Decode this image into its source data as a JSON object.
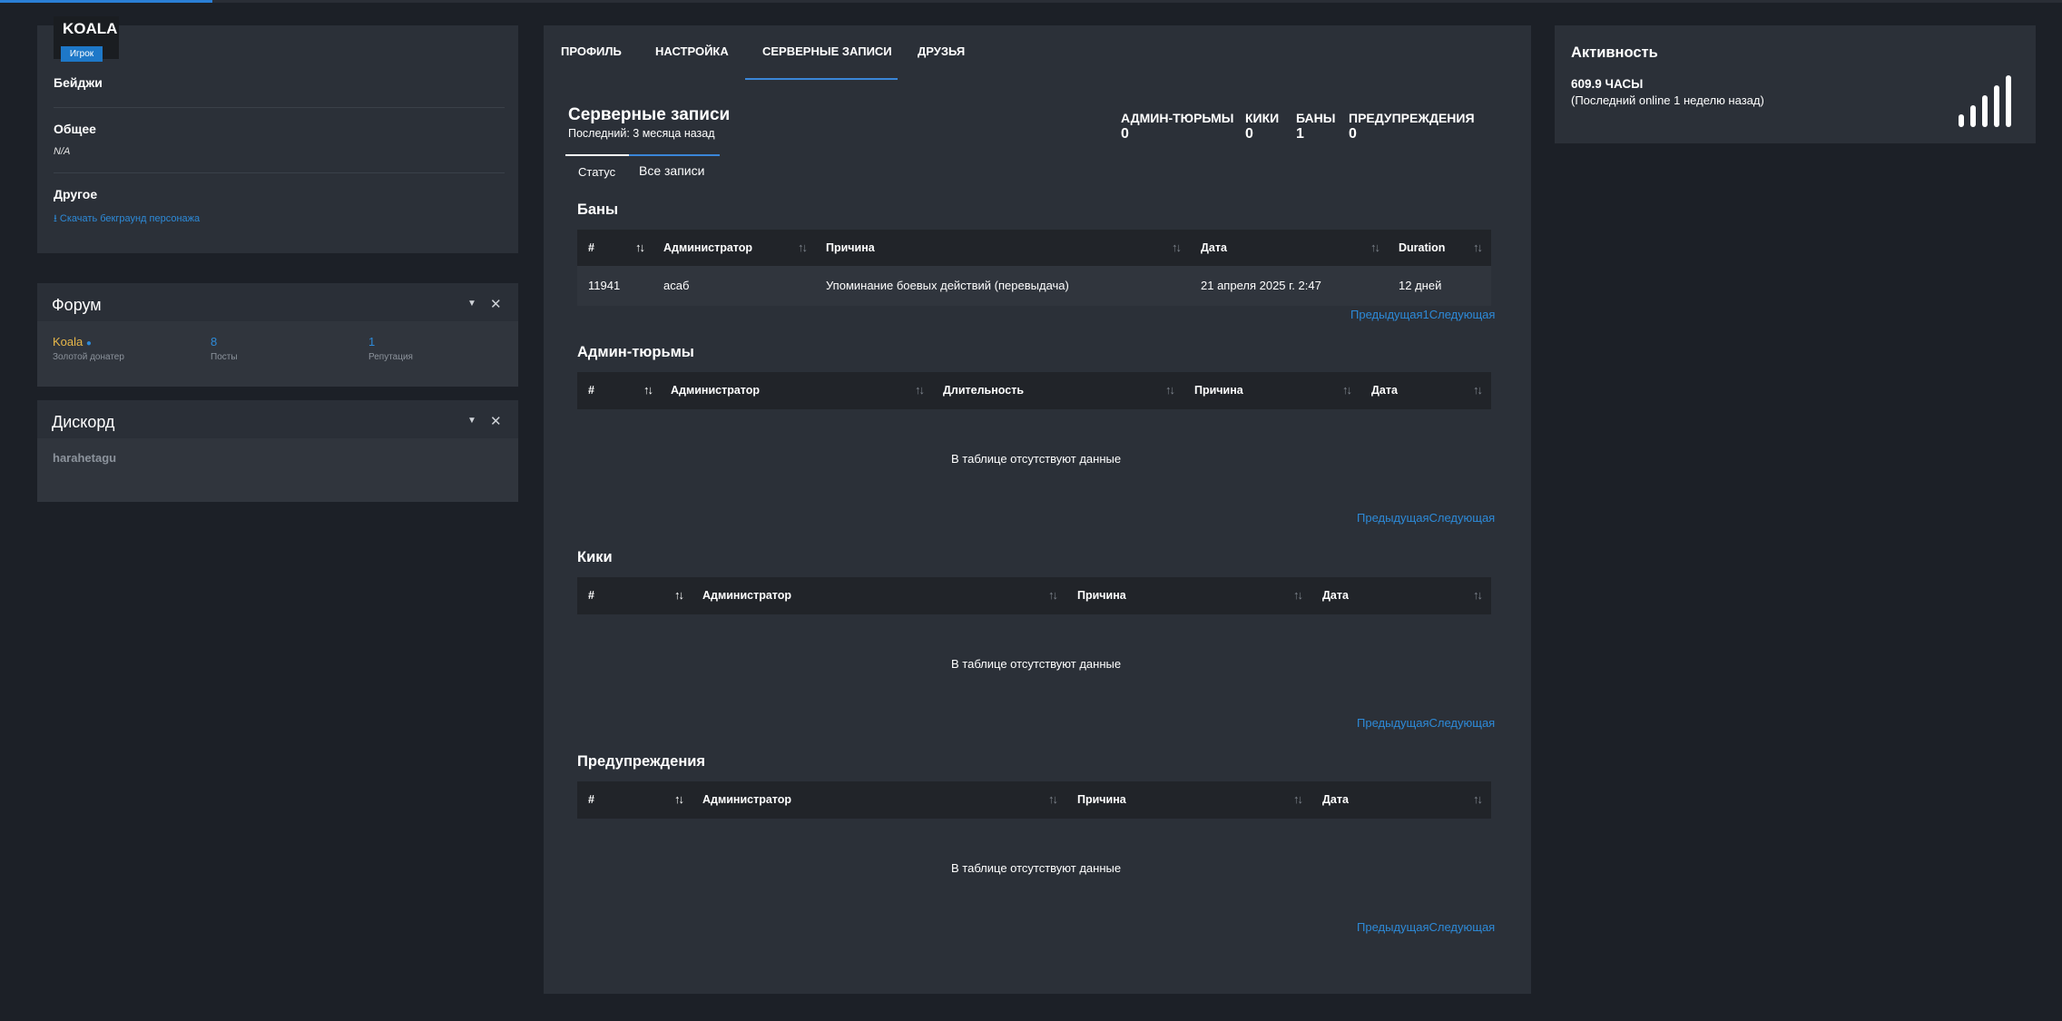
{
  "player": {
    "name": "KOALA",
    "role": "Игрок",
    "badges_label": "Бейджи",
    "general_label": "Общее",
    "general_value": "N/A",
    "other_label": "Другое",
    "download_link": "Скачать бекграунд персонажа"
  },
  "forum": {
    "title": "Форум",
    "username": "Koala",
    "user_rank": "Золотой донатер",
    "posts_value": "8",
    "posts_label": "Посты",
    "rep_value": "1",
    "rep_label": "Репутация"
  },
  "discord": {
    "title": "Дискорд",
    "username": "harahetagu"
  },
  "tabs": [
    "ПРОФИЛЬ",
    "НАСТРОЙКА",
    "СЕРВЕРНЫЕ ЗАПИСИ",
    "ДРУЗЬЯ"
  ],
  "records": {
    "title": "Серверные записи",
    "subtitle": "Последний: 3 месяца назад",
    "subtabs": [
      "Статус",
      "Все записи"
    ],
    "stats": [
      {
        "label": "АДМИН-ТЮРЬМЫ",
        "value": "0"
      },
      {
        "label": "КИКИ",
        "value": "0"
      },
      {
        "label": "БАНЫ",
        "value": "1"
      },
      {
        "label": "ПРЕДУПРЕЖДЕНИЯ",
        "value": "0"
      }
    ]
  },
  "bans": {
    "title": "Баны",
    "headers": [
      "#",
      "Администратор",
      "Причина",
      "Дата",
      "Duration"
    ],
    "rows": [
      [
        "11941",
        "acaб",
        "Упоминание боевых действий (перевыдача)",
        "21 апреля 2025 г. 2:47",
        "12 дней"
      ]
    ],
    "pager_prev": "Предыдущая",
    "pager_page": "1",
    "pager_next": "Следующая"
  },
  "jails": {
    "title": "Админ-тюрьмы",
    "headers": [
      "#",
      "Администратор",
      "Длительность",
      "Причина",
      "Дата"
    ],
    "empty": "В таблице отсутствуют данные",
    "pager_prev": "Предыдущая",
    "pager_next": "Следующая"
  },
  "kicks": {
    "title": "Кики",
    "headers": [
      "#",
      "Администратор",
      "Причина",
      "Дата"
    ],
    "empty": "В таблице отсутствуют данные",
    "pager_prev": "Предыдущая",
    "pager_next": "Следующая"
  },
  "warnings": {
    "title": "Предупреждения",
    "headers": [
      "#",
      "Администратор",
      "Причина",
      "Дата"
    ],
    "empty": "В таблице отсутствуют данные",
    "pager_prev": "Предыдущая",
    "pager_next": "Следующая"
  },
  "activity": {
    "title": "Активность",
    "hours": "609.9 ЧАСЫ",
    "last_online": "(Последний online 1 неделю назад)",
    "icon": "signal-bars-icon"
  }
}
